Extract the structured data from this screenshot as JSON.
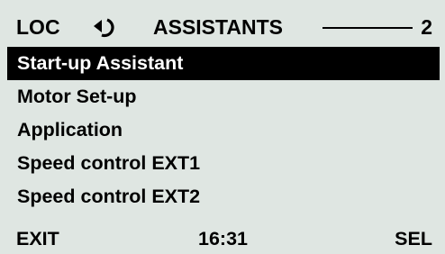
{
  "header": {
    "mode": "LOC",
    "direction_icon": "rotation-direction-icon",
    "title": "ASSISTANTS",
    "page": "2"
  },
  "menu": {
    "items": [
      {
        "label": "Start-up Assistant",
        "selected": true
      },
      {
        "label": "Motor Set-up",
        "selected": false
      },
      {
        "label": "Application",
        "selected": false
      },
      {
        "label": "Speed control EXT1",
        "selected": false
      },
      {
        "label": "Speed control EXT2",
        "selected": false
      }
    ]
  },
  "footer": {
    "left_softkey": "EXIT",
    "time": "16:31",
    "right_softkey": "SEL"
  },
  "colors": {
    "background": "#dfe6e2",
    "text": "#000000",
    "selection_bg": "#000000",
    "selection_text": "#ffffff"
  }
}
